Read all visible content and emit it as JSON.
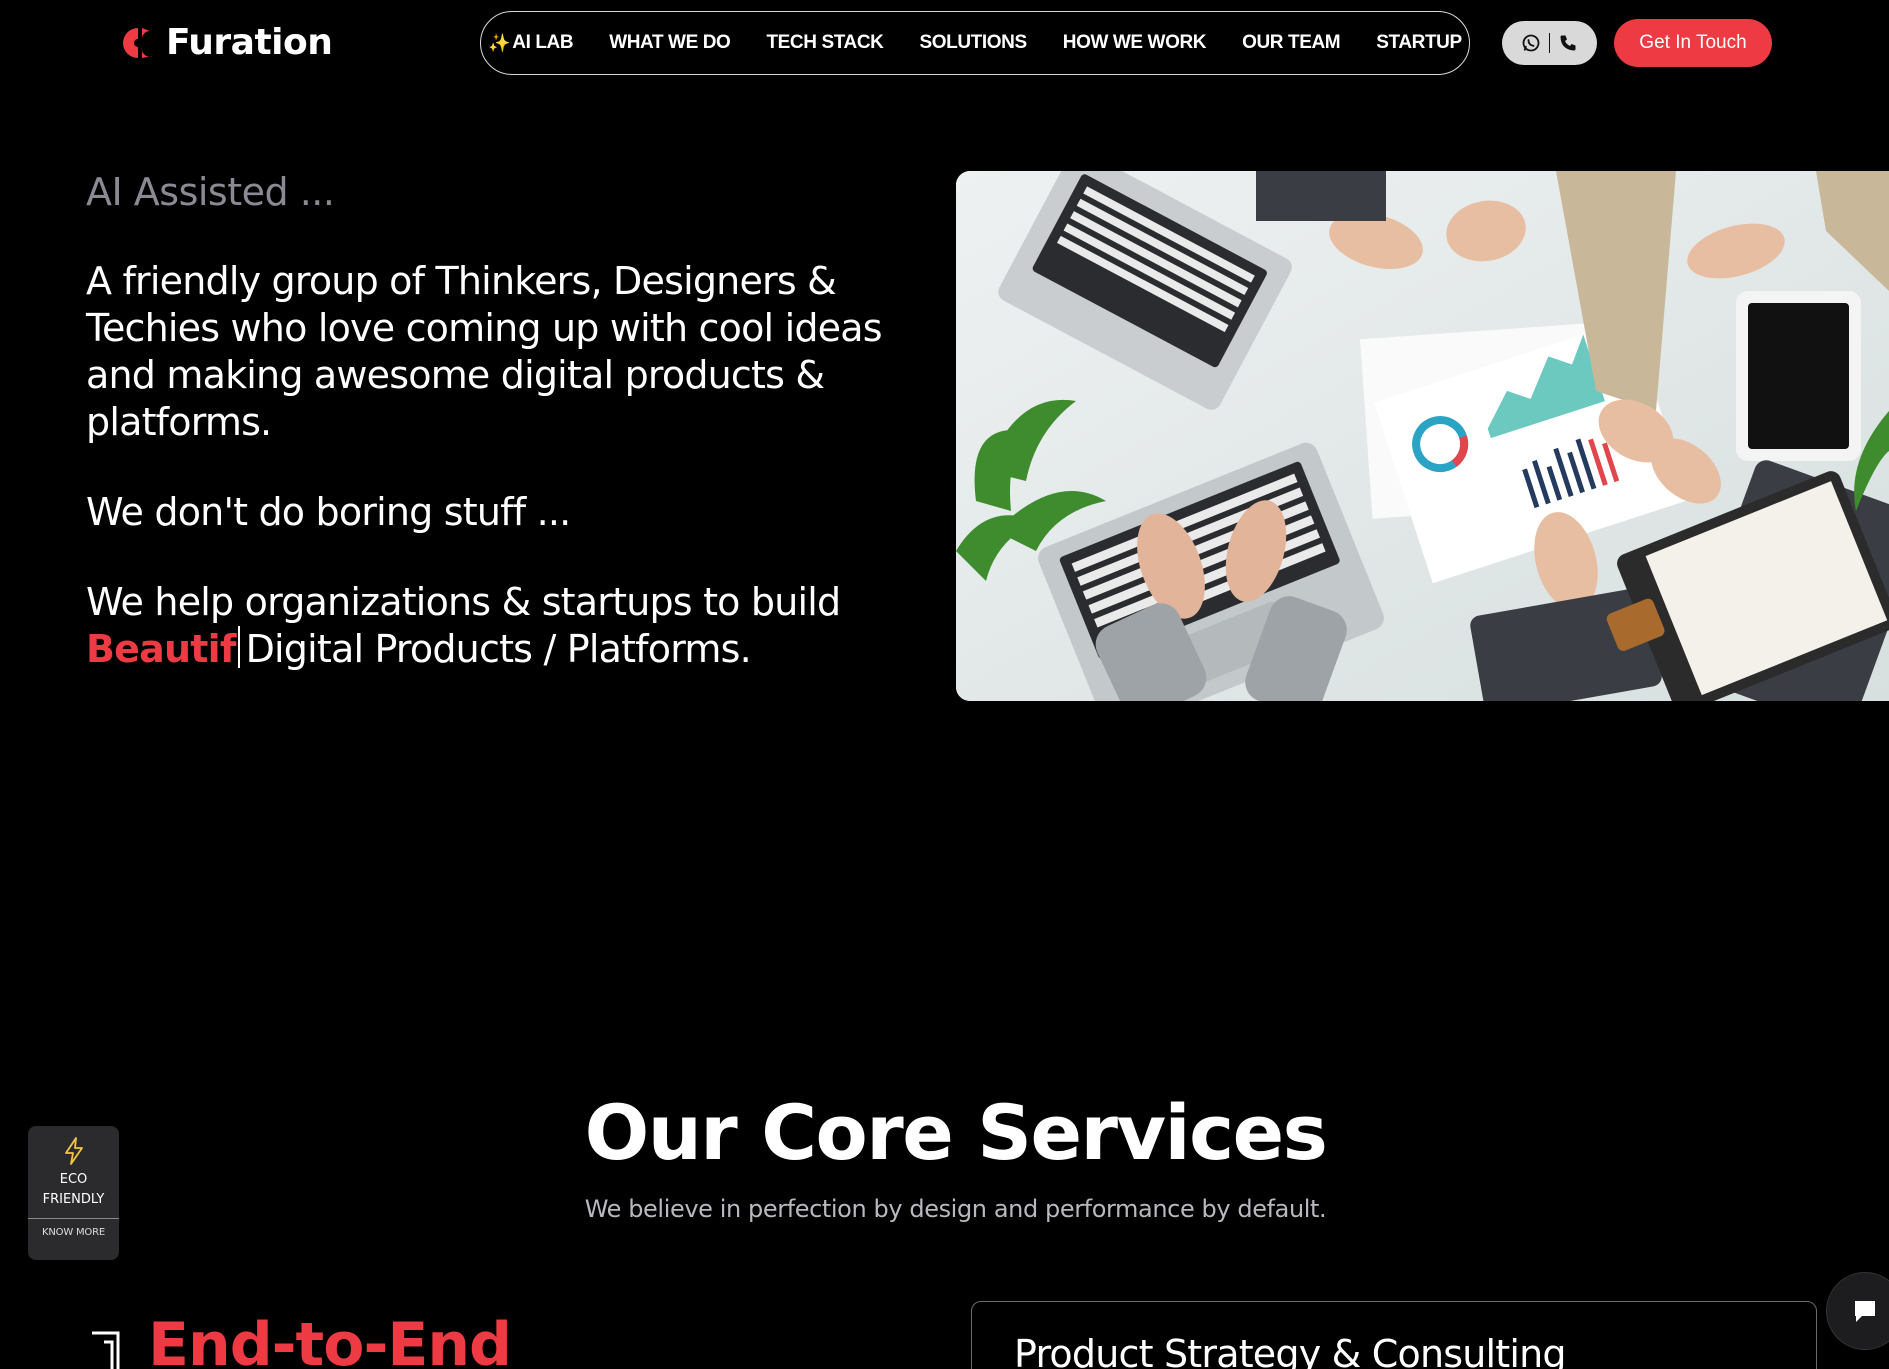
{
  "brand": {
    "name": "Furation",
    "accent_color": "#ee3a43"
  },
  "nav": {
    "items": [
      {
        "label": "AI LAB",
        "icon": "sparkles-icon"
      },
      {
        "label": "WHAT WE DO"
      },
      {
        "label": "TECH STACK"
      },
      {
        "label": "SOLUTIONS"
      },
      {
        "label": "HOW WE WORK"
      },
      {
        "label": "OUR TEAM"
      },
      {
        "label": "STARTUP"
      }
    ],
    "contact_icons": [
      "whatsapp-icon",
      "phone-icon"
    ],
    "cta_label": "Get In Touch"
  },
  "hero": {
    "eyebrow": "AI Assisted ...",
    "intro": "A friendly group of Thinkers, Designers & Techies who love coming up with cool ideas and making awesome digital products & platforms.",
    "tagline": "We don't do boring stuff ...",
    "help_line": "We help organizations & startups to build",
    "typed_word": "Beautif",
    "typed_suffix": "Digital Products / Platforms."
  },
  "services": {
    "title": "Our Core Services",
    "subtitle": "We believe in perfection by design and performance by default.",
    "step_heading": "End-to-End",
    "cards": [
      {
        "title": "Product Strategy & Consulting"
      }
    ]
  },
  "eco_badge": {
    "icon": "lightning-bolt-icon",
    "line1": "ECO",
    "line2": "FRIENDLY",
    "link": "KNOW MORE",
    "icon_color": "#f5c542"
  },
  "chat": {
    "icon": "chat-bubble-icon"
  }
}
